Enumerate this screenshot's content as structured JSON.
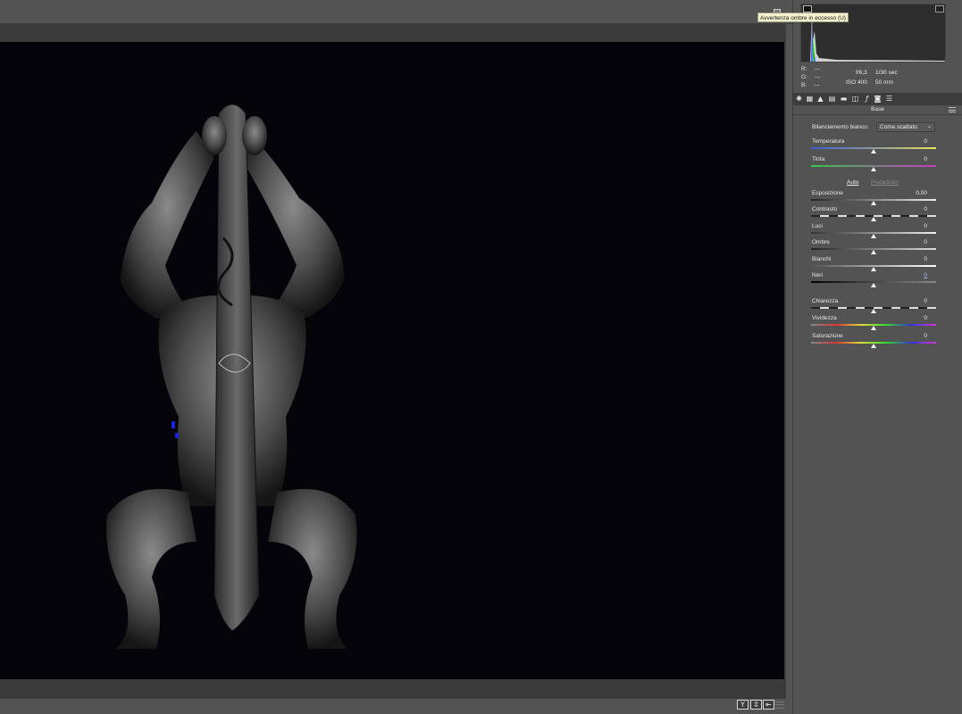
{
  "tooltip": "Avvertenza ombre in eccesso (U)",
  "rgb": {
    "r_label": "R:",
    "g_label": "G:",
    "b_label": "B:",
    "r_val": "---",
    "g_val": "---",
    "b_val": "---"
  },
  "exif": {
    "aperture": "f/6,3",
    "shutter": "1/30 sec",
    "iso": "ISO 400",
    "focal": "50 mm"
  },
  "section_title": "Base",
  "white_balance": {
    "label": "Bilanciamento bianco:",
    "value": "Come scattato"
  },
  "auto_label": "Auto",
  "default_label": "Predefinito",
  "sliders": {
    "temperatura": {
      "label": "Temperatura",
      "value": "0",
      "level": 0.5
    },
    "tinta": {
      "label": "Tinta",
      "value": "0",
      "level": 0.5
    },
    "esposizione": {
      "label": "Esposizione",
      "value": "0,00",
      "level": 0.5
    },
    "contrasto": {
      "label": "Contrasto",
      "value": "0",
      "level": 0.5
    },
    "luci": {
      "label": "Luci",
      "value": "0",
      "level": 0.5
    },
    "ombre": {
      "label": "Ombre",
      "value": "0",
      "level": 0.5
    },
    "bianchi": {
      "label": "Bianchi",
      "value": "0",
      "level": 0.5
    },
    "neri": {
      "label": "Neri",
      "value": "0",
      "level": 0.5
    },
    "chiarezza": {
      "label": "Chiarezza",
      "value": "0",
      "level": 0.5
    },
    "vividezza": {
      "label": "Vividezza",
      "value": "0",
      "level": 0.5
    },
    "saturazione": {
      "label": "Saturazione",
      "value": "0",
      "level": 0.5
    }
  },
  "view_buttons": [
    "Y",
    "⇕",
    "⇤"
  ],
  "colors": {
    "panel": "#535353",
    "canvas": "#04040a",
    "accent": "#9cc3ff"
  },
  "icons": [
    "aperture-icon",
    "tone-curve-icon",
    "detail-icon",
    "hsl-icon",
    "split-toning-icon",
    "lens-icon",
    "effects-icon",
    "camera-calibration-icon",
    "presets-icon"
  ]
}
